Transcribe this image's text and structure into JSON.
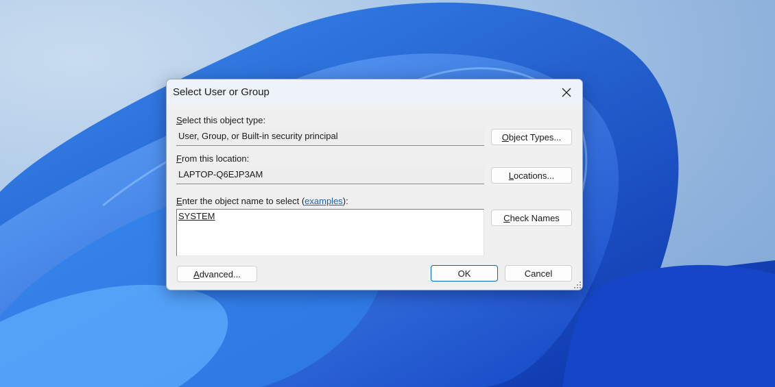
{
  "dialog": {
    "title": "Select User or Group",
    "object_type_label": {
      "key": "S",
      "rest": "elect this object type:"
    },
    "object_type_value": "User, Group, or Built-in security principal",
    "object_types_button": {
      "key": "O",
      "rest": "bject Types..."
    },
    "location_label": {
      "key": "F",
      "rest": "rom this location:"
    },
    "location_value": "LAPTOP-Q6EJP3AM",
    "locations_button": {
      "key": "L",
      "rest": "ocations..."
    },
    "name_label": {
      "key": "E",
      "rest": "nter the object name to select (",
      "link": "examples",
      "end": "):"
    },
    "name_value": "SYSTEM",
    "check_names_button": {
      "key": "C",
      "rest": "heck Names"
    },
    "advanced_button": {
      "key": "A",
      "rest": "dvanced..."
    },
    "ok_button": "OK",
    "cancel_button": "Cancel"
  },
  "colors": {
    "accent": "#0067c0",
    "link": "#1a64b0"
  }
}
